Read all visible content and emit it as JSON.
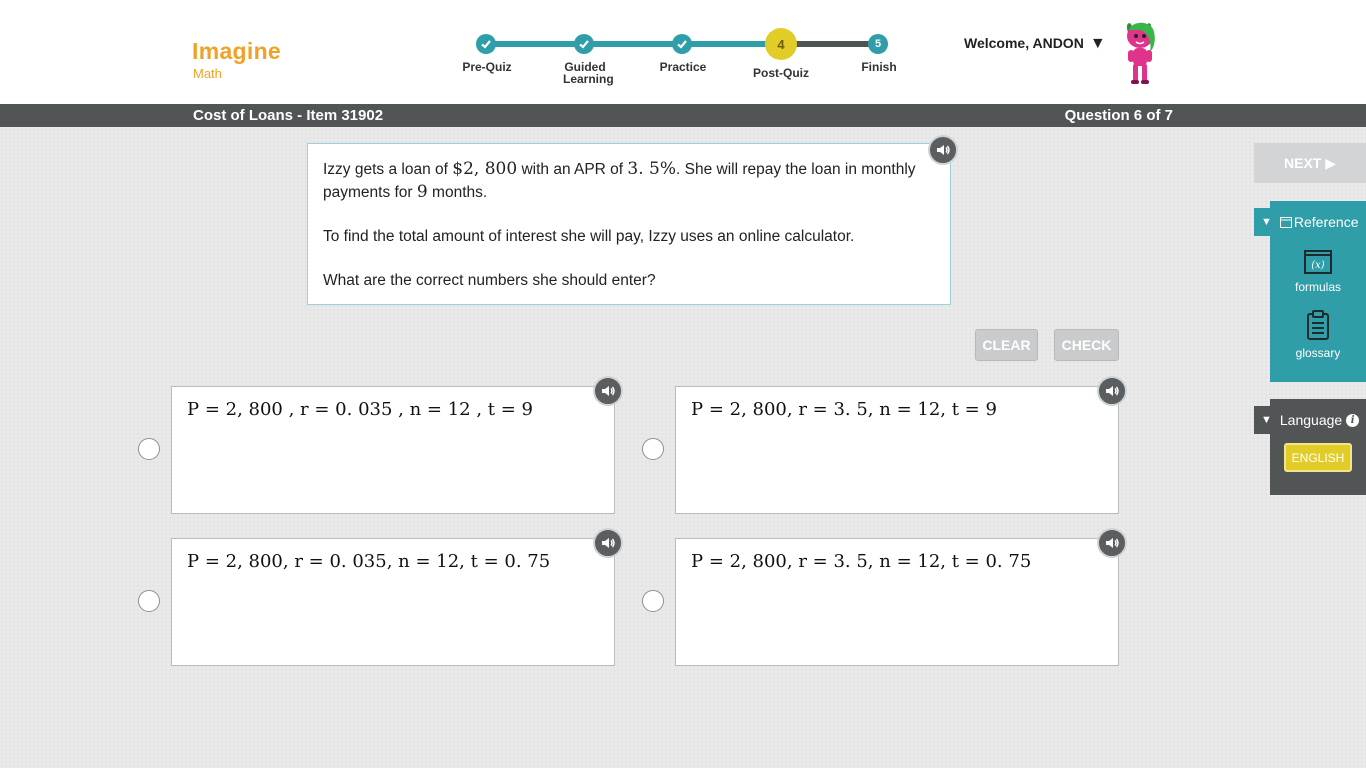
{
  "app": {
    "logo_main": "Imagine",
    "logo_sub": "Math"
  },
  "progress": {
    "steps": [
      {
        "label": "Pre-Quiz",
        "state": "done"
      },
      {
        "label": "Guided Learning",
        "state": "done"
      },
      {
        "label": "Practice",
        "state": "done"
      },
      {
        "label": "Post-Quiz",
        "state": "current",
        "number": "4"
      },
      {
        "label": "Finish",
        "state": "todo",
        "number": "5"
      }
    ]
  },
  "user": {
    "welcome": "Welcome, ANDON",
    "caret": "▼"
  },
  "titlebar": {
    "item_title": "Cost of Loans - Item 31902",
    "question_count": "Question 6 of 7"
  },
  "question": {
    "line1_a": "Izzy gets a loan of ",
    "line1_amount": "$2, 800",
    "line1_b": " with an APR of ",
    "line1_rate": "3. 5%",
    "line1_c": ". She will repay the loan in monthly payments for ",
    "line1_months": "9",
    "line1_d": " months.",
    "paragraph2": "To find the total amount of interest she will pay, Izzy uses an online calculator.",
    "paragraph3": "What are the correct numbers she should enter?"
  },
  "buttons": {
    "clear": "CLEAR",
    "check": "CHECK",
    "next": "NEXT ▶"
  },
  "choices": [
    {
      "text": "P = 2, 800 ,  r = 0. 035 ,  n = 12 ,  t = 9"
    },
    {
      "text": "P = 2, 800,  r = 3. 5,  n = 12,  t = 9"
    },
    {
      "text": "P = 2, 800,  r = 0. 035,  n = 12,  t = 0. 75"
    },
    {
      "text": "P = 2, 800,  r = 3. 5,  n = 12,  t = 0. 75"
    }
  ],
  "reference": {
    "header": "Reference",
    "items": [
      {
        "label": "formulas",
        "icon": "formula-icon",
        "glyph": "(x)"
      },
      {
        "label": "glossary",
        "icon": "clipboard-icon"
      }
    ]
  },
  "language": {
    "header": "Language",
    "selected": "ENGLISH",
    "info_glyph": "i"
  },
  "colors": {
    "accent_teal": "#2f9ea8",
    "accent_yellow": "#e2cc28",
    "logo_orange": "#f0a227",
    "dark_bar": "#515556"
  }
}
